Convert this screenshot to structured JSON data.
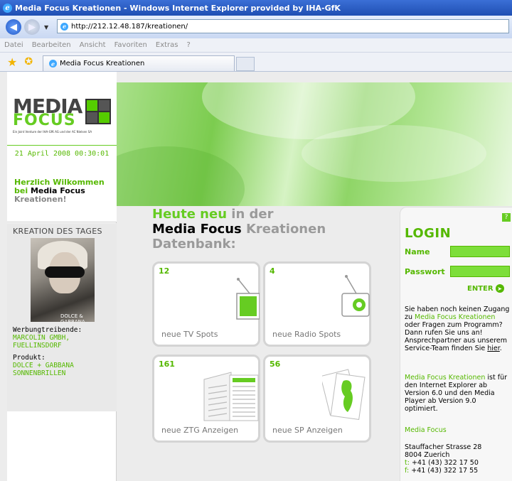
{
  "browser": {
    "title": "Media Focus Kreationen - Windows Internet Explorer provided by IHA-GfK",
    "address": "http://212.12.48.187/kreationen/",
    "menu": [
      "Datei",
      "Bearbeiten",
      "Ansicht",
      "Favoriten",
      "Extras",
      "?"
    ],
    "tab_title": "Media Focus Kreationen"
  },
  "logo": {
    "word1": "MEDIA",
    "word2": "FOCUS",
    "subtitle": "Ein Joint Venture der IHA-GfK AG und der AC Nielsen SA"
  },
  "left": {
    "date": "21 April 2008 00:30:01",
    "welcome_1": "Herzlich Wilkommen",
    "welcome_2a": "bei ",
    "welcome_2b": "Media Focus",
    "welcome_3": "Kreationen!",
    "kdt_title": "KREATION DES TAGES",
    "image_label": "DOLCE & GABBANA",
    "advertiser_label": "Werbungtreibende:",
    "advertiser_value": "MARCOLIN GMBH, FUELLINSDORF",
    "product_label": "Produkt:",
    "product_value": "DOLCE + GABBANA SONNENBRILLEN"
  },
  "center": {
    "heading_1a": "Heute neu",
    "heading_1b": " in der",
    "heading_2a": "Media Focus",
    "heading_2b": " Kreationen",
    "heading_3": "Datenbank:",
    "tiles": [
      {
        "count": "12",
        "label": "neue TV Spots",
        "icon": "tv-icon"
      },
      {
        "count": "4",
        "label": "neue Radio Spots",
        "icon": "radio-icon"
      },
      {
        "count": "161",
        "label": "neue ZTG Anzeigen",
        "icon": "newspaper-icon"
      },
      {
        "count": "56",
        "label": "neue SP Anzeigen",
        "icon": "poster-icon"
      }
    ]
  },
  "login": {
    "help": "?",
    "title": "LOGIN",
    "name_label": "Name",
    "password_label": "Passwort",
    "enter_label": "ENTER",
    "info1_a": "Sie haben noch keinen Zugang zu ",
    "info1_b": "Media Focus Kreationen",
    "info1_c": " oder Fragen zum Programm? Dann rufen Sie uns an! Ansprechpartner aus unserem Service-Team finden Sie ",
    "info1_link": "hier",
    "info1_d": ".",
    "info2_a": "Media Focus Kreationen",
    "info2_b": " ist für den Internet Explorer ab Version 6.0 und den Media Player ab Version 9.0 optimiert.",
    "company": "Media Focus",
    "street": "Stauffacher Strasse 28",
    "city": "8004 Zuerich",
    "tel_prefix": "t:",
    "tel": " +41 (43) 322 17 50",
    "fax_prefix": "f:",
    "fax": " +41 (43) 322 17 55"
  },
  "colors": {
    "accent": "#66cc22",
    "accent_dark": "#55b800",
    "grey": "#9a9a9a"
  }
}
